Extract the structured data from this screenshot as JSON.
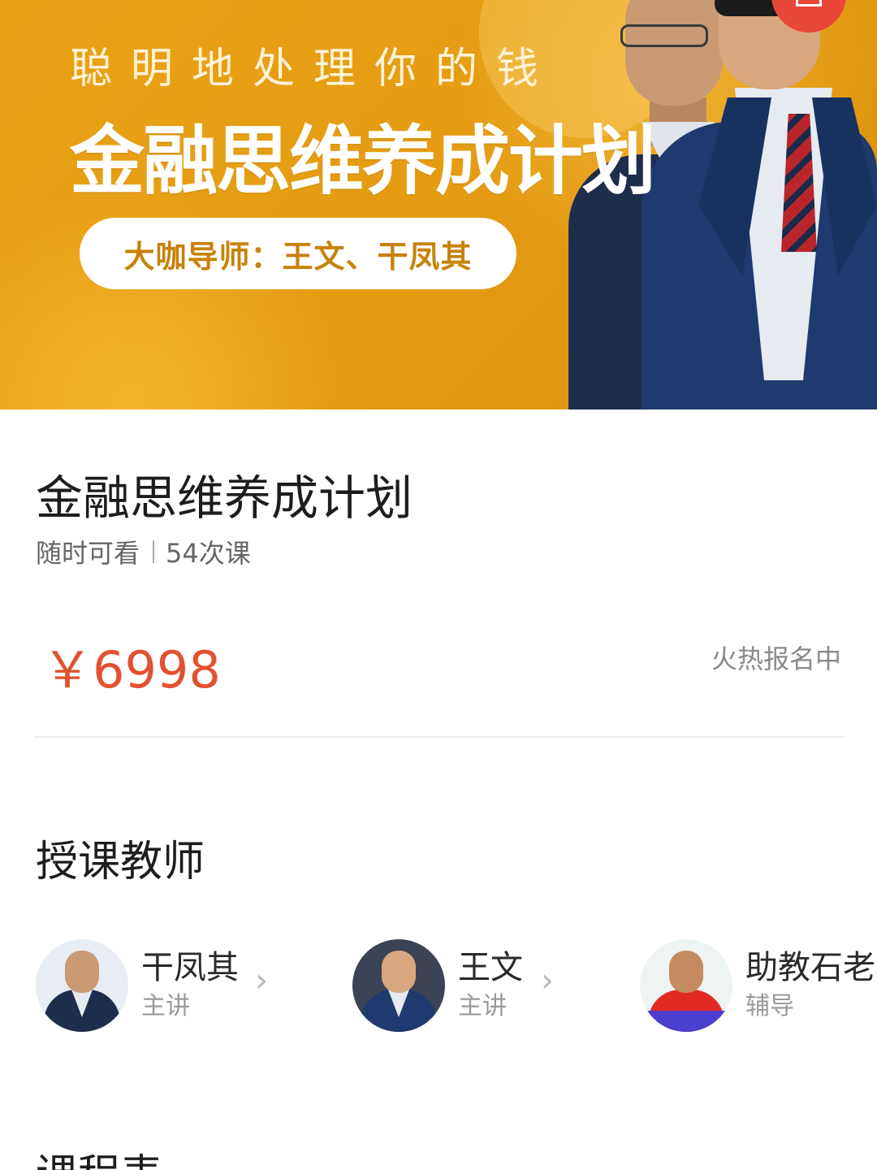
{
  "banner": {
    "subtitle": "聪明地处理你的钱",
    "title": "金融思维养成计划",
    "pill_text": "大咖导师：王文、干凤其",
    "colors": {
      "background": "#e49b12",
      "pill_text": "#c8820a",
      "share_badge": "#e8473a"
    }
  },
  "course": {
    "title": "金融思维养成计划",
    "availability": "随时可看",
    "lessons": "54次课",
    "price": "￥6998",
    "status": "火热报名中",
    "colors": {
      "price": "#e2512f"
    }
  },
  "teachers_section": {
    "title": "授课教师",
    "teachers": [
      {
        "name": "干凤其",
        "role": "主讲",
        "chevron": "›"
      },
      {
        "name": "王文",
        "role": "主讲",
        "chevron": "›"
      },
      {
        "name": "助教石老",
        "role": "辅导"
      }
    ]
  },
  "schedule_section": {
    "title": "课程表"
  }
}
